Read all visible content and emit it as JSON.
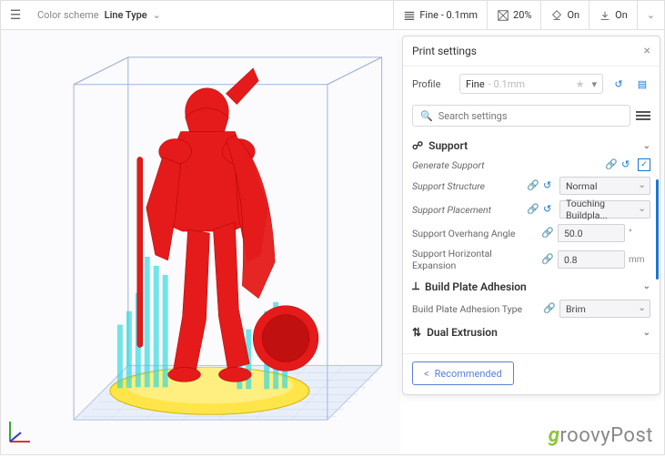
{
  "topbar": {
    "colorscheme_label": "Color scheme",
    "colorscheme_value": "Line Type",
    "quality": {
      "label": "Fine - 0.1mm"
    },
    "infill": {
      "value": "20%"
    },
    "support": {
      "label": "On"
    },
    "adhesion": {
      "label": "On"
    }
  },
  "panel": {
    "title": "Print settings",
    "profile_label": "Profile",
    "profile_value": "Fine",
    "profile_dim": "- 0.1mm",
    "search_placeholder": "Search settings",
    "sections": {
      "support": {
        "title": "Support",
        "generate": {
          "label": "Generate Support",
          "checked": true
        },
        "structure": {
          "label": "Support Structure",
          "value": "Normal"
        },
        "placement": {
          "label": "Support Placement",
          "value": "Touching Buildpla..."
        },
        "overhang": {
          "label": "Support Overhang Angle",
          "value": "50.0",
          "unit": "°"
        },
        "hexp": {
          "label": "Support Horizontal Expansion",
          "value": "0.8",
          "unit": "mm"
        }
      },
      "adhesion": {
        "title": "Build Plate Adhesion",
        "type": {
          "label": "Build Plate Adhesion Type",
          "value": "Brim"
        }
      },
      "dual": {
        "title": "Dual Extrusion"
      }
    },
    "recommended": "Recommended"
  },
  "watermark": {
    "g": "g",
    "rest": "roovyPost"
  }
}
